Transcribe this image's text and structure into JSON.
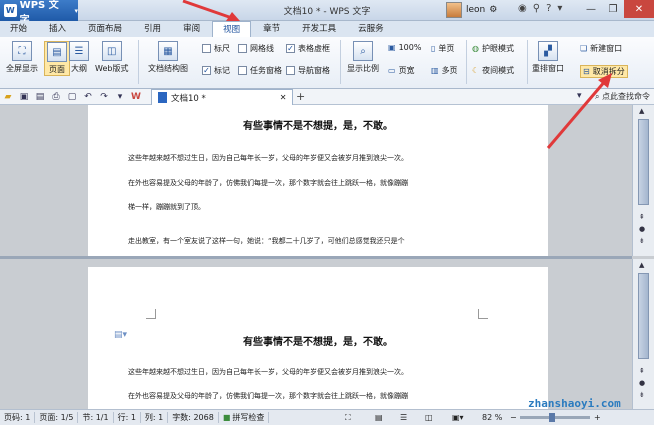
{
  "app": {
    "name": "WPS 文字",
    "window_title": "文档10 * - WPS 文字",
    "user": "leon"
  },
  "tabs": [
    "开始",
    "插入",
    "页面布局",
    "引用",
    "审阅",
    "视图",
    "章节",
    "开发工具",
    "云服务"
  ],
  "ribbon": {
    "fullscreen": "全屏显示",
    "page": "页面",
    "outline": "大纲",
    "web": "Web版式",
    "doc_map": "文档结构图",
    "ruler": "标尺",
    "gridlines": "网格线",
    "table_gridlines": "表格虚框",
    "marks": "标记",
    "task_pane": "任务窗格",
    "nav_pane": "导航窗格",
    "zoom_ratio": "显示比例",
    "zoom_100": "100%",
    "page_width": "页宽",
    "single_page": "单页",
    "multi_page": "多页",
    "eye_mode": "护眼模式",
    "night_mode": "夜间模式",
    "rearrange": "重排窗口",
    "new_window": "新建窗口",
    "split": "取消拆分"
  },
  "qat": {
    "doc_tab": "文档10 *",
    "search": "点此查找命令"
  },
  "document": {
    "title": "有些事情不是不想提，是，不敢。",
    "lines": [
      "这些年越来越不想过生日，因为自己每年长一岁，父母的年岁便又会被岁月推到浪尖一次。",
      "在外也容易提及父母的年龄了，仿佛我们每提一次，那个数字就会往上跳跃一格，就像蹦蹦",
      "梯一样，蹦蹦就到了顶。",
      "走出教室，有一个室友说了这样一句，她说：“我都二十几岁了，可他们总感觉我还只是个"
    ]
  },
  "status": {
    "page": "页码: 1",
    "pages": "页面: 1/5",
    "section": "节: 1/1",
    "row": "行: 1",
    "col": "列: 1",
    "words": "字数: 2068",
    "spell": "拼写检查",
    "zoom": "82 %",
    "zoom_level": 0.45
  },
  "watermark": "zhanshaoyi.com",
  "colors": {
    "accent": "#1f5aa8",
    "close": "#c9473f",
    "arrow": "#e0393a"
  }
}
